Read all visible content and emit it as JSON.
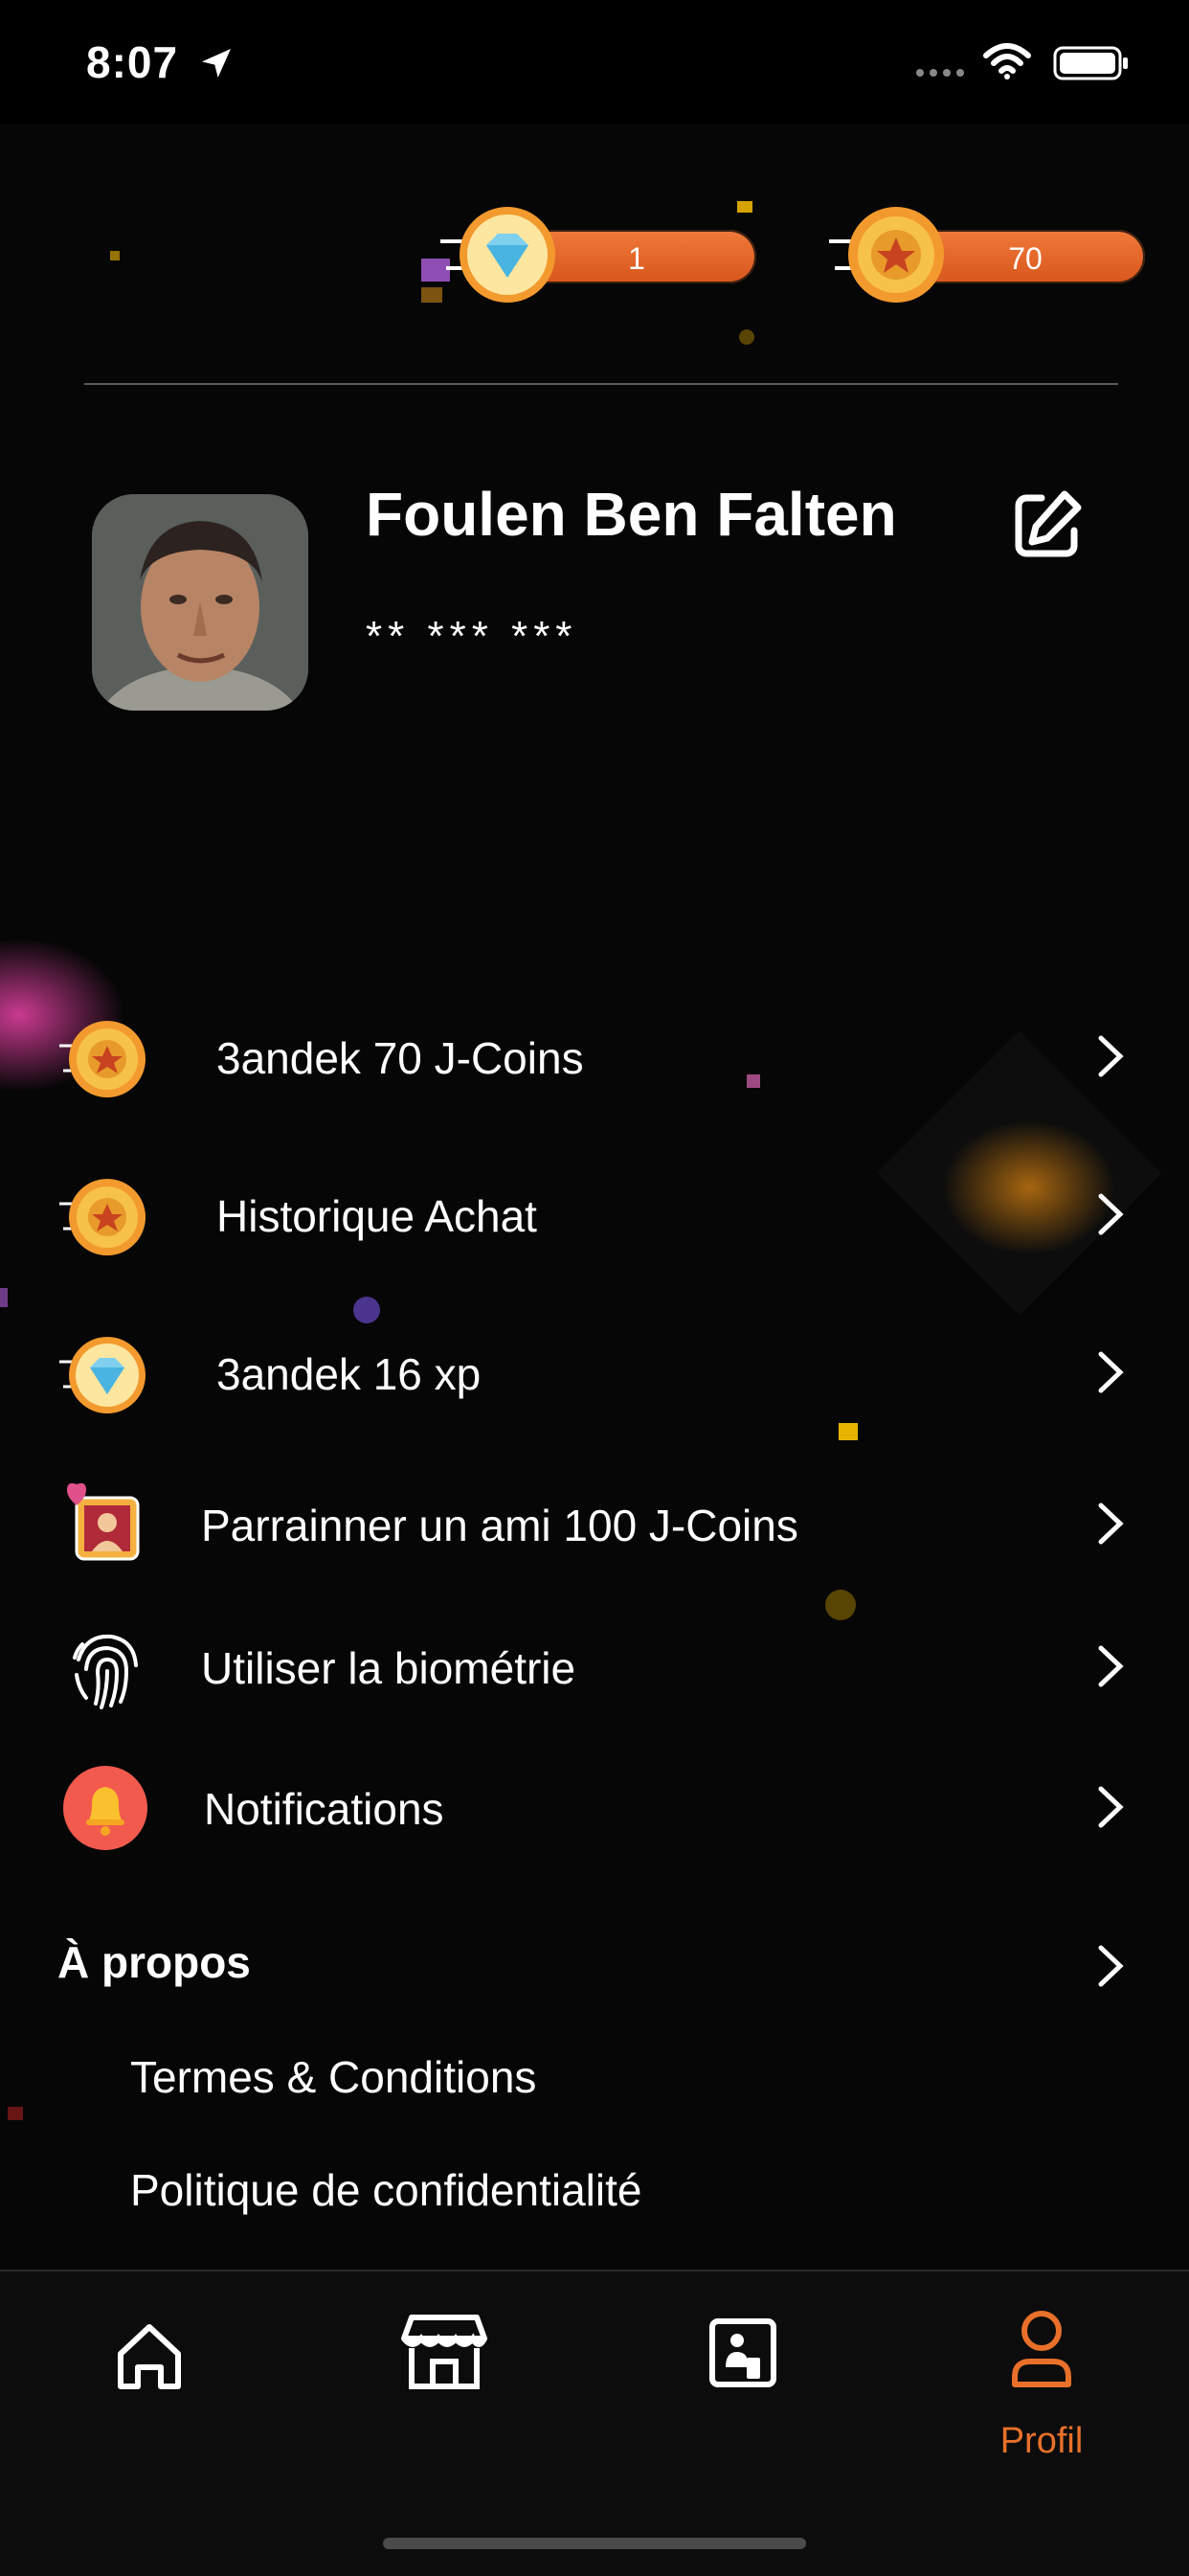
{
  "status_bar": {
    "time": "8:07"
  },
  "counters": {
    "diamonds": "1",
    "coins": "70"
  },
  "profile": {
    "name": "Foulen Ben Falten",
    "phone": "** *** ***"
  },
  "menu": [
    {
      "label": "3andek 70 J-Coins",
      "icon": "coin-icon"
    },
    {
      "label": "Historique Achat",
      "icon": "coin-icon"
    },
    {
      "label": "3andek 16 xp",
      "icon": "diamond-icon"
    },
    {
      "label": "Parrainner un ami  100 J-Coins",
      "icon": "referral-icon"
    },
    {
      "label": "Utiliser la biométrie",
      "icon": "fingerprint-icon"
    },
    {
      "label": "Notifications",
      "icon": "bell-icon"
    }
  ],
  "about": {
    "title": "À propos",
    "links": [
      "Termes & Conditions",
      "Politique de confidentialité"
    ]
  },
  "tabs": [
    {
      "name": "home",
      "icon": "home-icon",
      "label": ""
    },
    {
      "name": "store",
      "icon": "store-icon",
      "label": ""
    },
    {
      "name": "card",
      "icon": "id-card-icon",
      "label": ""
    },
    {
      "name": "profile",
      "icon": "user-icon",
      "label": "Profil",
      "active": true
    }
  ],
  "colors": {
    "accent": "#e8702a",
    "background": "#060606",
    "coin": "#f5a623",
    "bell_bg": "#f25a4e"
  }
}
